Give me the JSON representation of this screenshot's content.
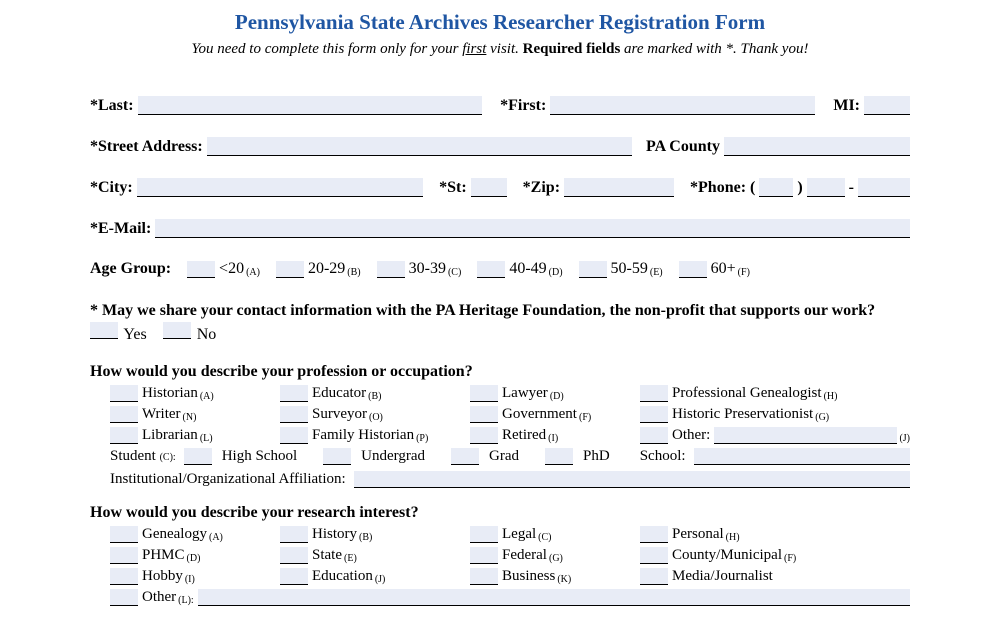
{
  "title": "Pennsylvania State Archives Researcher Registration Form",
  "subtitle_parts": {
    "p1": "You need to complete this form only for your ",
    "first": "first",
    "p2": " visit. ",
    "req": "Required fields",
    "p3": " are marked with *. Thank you!"
  },
  "labels": {
    "last": "*Last:",
    "first": "*First:",
    "mi": "MI:",
    "street": "*Street Address:",
    "pacounty": "PA County",
    "city": "*City:",
    "st": "*St:",
    "zip": "*Zip:",
    "phone": "*Phone: (",
    "phone_sep": ")  ",
    "phone_dash": "-",
    "email": "*E-Mail:",
    "age_group": "Age Group:"
  },
  "age_options": [
    {
      "label": "<20",
      "sub": "(A)"
    },
    {
      "label": "20-29",
      "sub": "(B)"
    },
    {
      "label": "30-39",
      "sub": "(C)"
    },
    {
      "label": "40-49",
      "sub": "(D)"
    },
    {
      "label": "50-59",
      "sub": "(E)"
    },
    {
      "label": "60+",
      "sub": "(F)"
    }
  ],
  "share_q": "* May we share your contact information with the PA Heritage Foundation, the non-profit that supports our work?",
  "yes": "Yes",
  "no": "No",
  "profession_q": "How would you describe your profession or occupation?",
  "profession_rows": [
    [
      {
        "t": "Historian",
        "s": "(A)"
      },
      {
        "t": "Educator",
        "s": "(B)"
      },
      {
        "t": "Lawyer",
        "s": "(D)"
      },
      {
        "t": "Professional Genealogist",
        "s": "(H)"
      }
    ],
    [
      {
        "t": "Writer",
        "s": "(N)"
      },
      {
        "t": "Surveyor",
        "s": "(O)"
      },
      {
        "t": "Government",
        "s": "(F)"
      },
      {
        "t": "Historic Preservationist",
        "s": "(G)"
      }
    ],
    [
      {
        "t": "Librarian",
        "s": "(L)"
      },
      {
        "t": "Family Historian",
        "s": "(P)"
      },
      {
        "t": "Retired",
        "s": "(I)"
      },
      {
        "t": "Other:",
        "s": "",
        "fill": true,
        "fillsub": "(J)"
      }
    ]
  ],
  "student": {
    "label": "Student",
    "sub": "(C):",
    "opts": [
      "High School",
      "Undergrad",
      "Grad",
      "PhD"
    ],
    "school": "School:"
  },
  "affiliation": "Institutional/Organizational Affiliation:",
  "research_q": "How would you describe your research interest?",
  "research_rows": [
    [
      {
        "t": "Genealogy",
        "s": "(A)"
      },
      {
        "t": "History",
        "s": "(B)"
      },
      {
        "t": "Legal",
        "s": "(C)"
      },
      {
        "t": "Personal",
        "s": "(H)"
      }
    ],
    [
      {
        "t": "PHMC",
        "s": "(D)"
      },
      {
        "t": "State",
        "s": "(E)"
      },
      {
        "t": "Federal",
        "s": "(G)"
      },
      {
        "t": "County/Municipal",
        "s": "(F)"
      }
    ],
    [
      {
        "t": "Hobby",
        "s": "(I)"
      },
      {
        "t": "Education",
        "s": "(J)"
      },
      {
        "t": "Business",
        "s": "(K)"
      },
      {
        "t": "Media/Journalist",
        "s": ""
      }
    ],
    [
      {
        "t": "Other",
        "s": "(L):",
        "fill": true
      }
    ]
  ]
}
